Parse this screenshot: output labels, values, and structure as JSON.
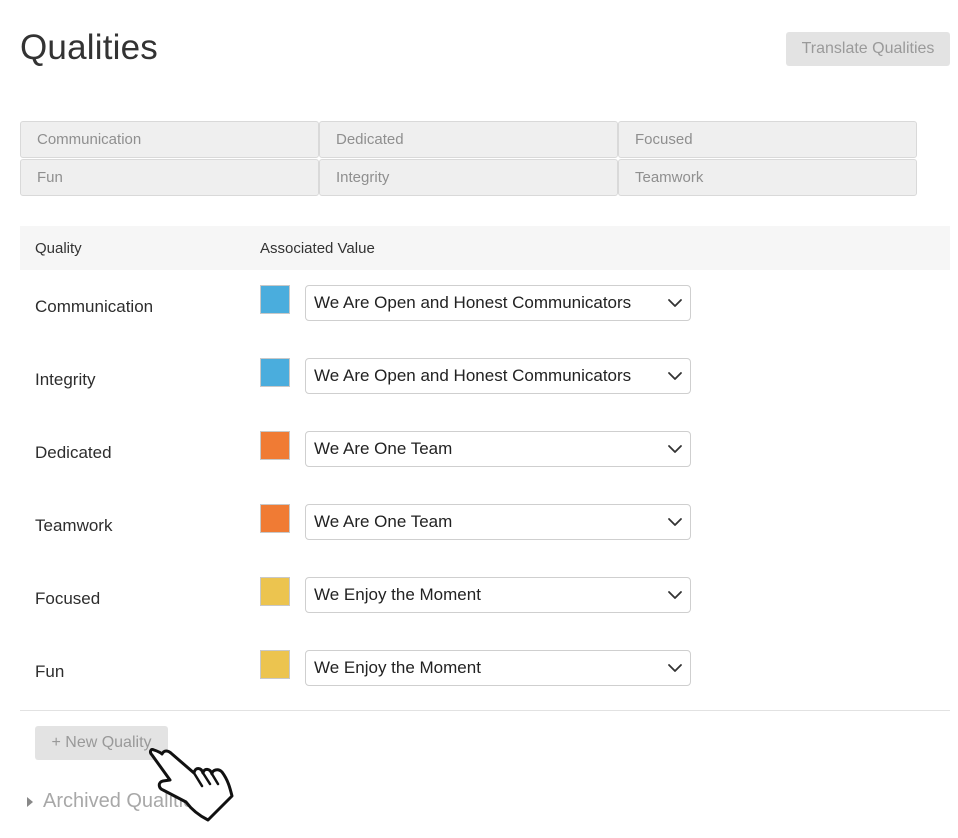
{
  "header": {
    "title": "Qualities",
    "translate_label": "Translate Qualities"
  },
  "chips": [
    {
      "label": "Communication"
    },
    {
      "label": "Dedicated"
    },
    {
      "label": "Focused"
    },
    {
      "label": "Fun"
    },
    {
      "label": "Integrity"
    },
    {
      "label": "Teamwork"
    }
  ],
  "table": {
    "headers": {
      "quality": "Quality",
      "value": "Associated Value"
    },
    "rows": [
      {
        "quality": "Communication",
        "value": "We Are Open and Honest Communicators",
        "color": "#4aaddd"
      },
      {
        "quality": "Integrity",
        "value": "We Are Open and Honest Communicators",
        "color": "#4aaddd"
      },
      {
        "quality": "Dedicated",
        "value": "We Are One Team",
        "color": "#f07b34"
      },
      {
        "quality": "Teamwork",
        "value": "We Are One Team",
        "color": "#f07b34"
      },
      {
        "quality": "Focused",
        "value": "We Enjoy the Moment",
        "color": "#ecc44f"
      },
      {
        "quality": "Fun",
        "value": "We Enjoy the Moment",
        "color": "#ecc44f"
      }
    ]
  },
  "footer": {
    "new_quality_label": "+ New Quality",
    "archived_label": "Archived Qualities"
  },
  "icons": {
    "dropdown": "chevron-down-icon",
    "archived": "caret-right-icon",
    "pointer": "hand-pointer-icon"
  }
}
